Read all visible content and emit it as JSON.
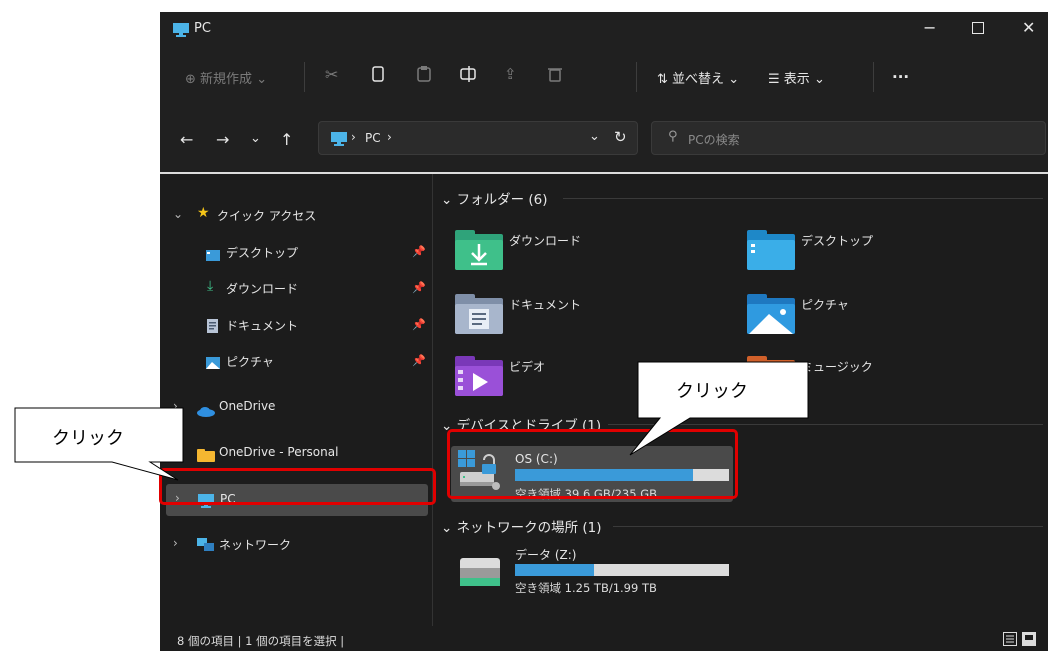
{
  "window": {
    "title": "PC"
  },
  "toolbar": {
    "new_label": "新規作成",
    "sort_label": "並べ替え",
    "view_label": "表示",
    "more_label": "..."
  },
  "address": {
    "path_label": "PC",
    "search_placeholder": "PCの検索"
  },
  "sidebar": {
    "quick_access": "クイック アクセス",
    "items": [
      {
        "label": "デスクトップ"
      },
      {
        "label": "ダウンロード"
      },
      {
        "label": "ドキュメント"
      },
      {
        "label": "ピクチャ"
      }
    ],
    "onedrive": "OneDrive",
    "onedrive_personal": "OneDrive - Personal",
    "pc": "PC",
    "network": "ネットワーク"
  },
  "content": {
    "folders_header": "フォルダー (6)",
    "folders": [
      {
        "label": "ダウンロード"
      },
      {
        "label": "デスクトップ"
      },
      {
        "label": "ドキュメント"
      },
      {
        "label": "ピクチャ"
      },
      {
        "label": "ビデオ"
      },
      {
        "label": "ミュージック"
      }
    ],
    "devices_header": "デバイスとドライブ (1)",
    "drive_c": {
      "name": "OS (C:)",
      "free_text": "空き領域 39.6 GB/235 GB",
      "used_fraction": 0.83
    },
    "network_header": "ネットワークの場所 (1)",
    "drive_z": {
      "name": "データ (Z:)",
      "free_text": "空き領域 1.25 TB/1.99 TB",
      "used_fraction": 0.37
    }
  },
  "status": {
    "text": "8 個の項目  |  1 個の項目を選択  |"
  },
  "annotations": {
    "callout_left": "クリック",
    "callout_right": "クリック"
  },
  "colors": {
    "accent": "#3a9ad9",
    "highlight": "#e00000",
    "selected": "#4a4a4a"
  }
}
